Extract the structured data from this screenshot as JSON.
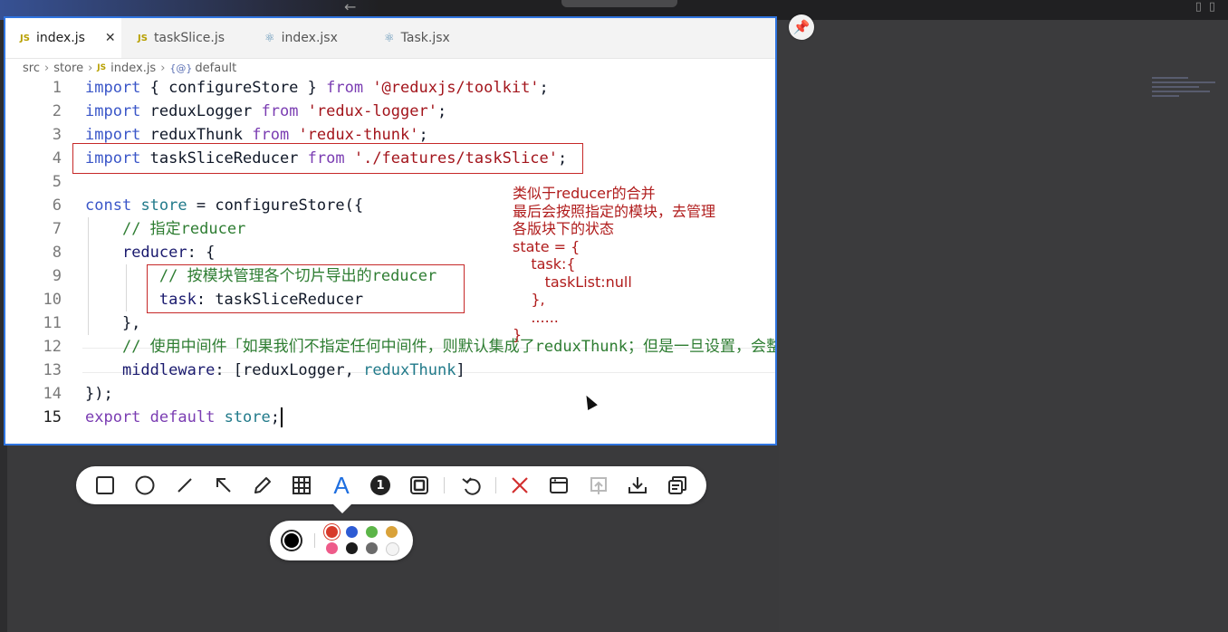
{
  "editor": {
    "tabs": [
      {
        "label": "index.js",
        "badge": "JS",
        "icon": "js-file-icon",
        "active": true,
        "close": "✕"
      },
      {
        "label": "taskSlice.js",
        "badge": "JS",
        "icon": "js-file-icon"
      },
      {
        "label": "index.jsx",
        "icon": "react-file-icon"
      },
      {
        "label": "Task.jsx",
        "icon": "react-file-icon"
      }
    ],
    "breadcrumb": {
      "folder1": "src",
      "folder2": "store",
      "file_badge": "JS",
      "file": "index.js",
      "symbol_icon": "{@}",
      "symbol": "default"
    },
    "lines": [
      {
        "n": "1",
        "parts": [
          [
            "kw",
            "import"
          ],
          [
            "var",
            " { configureStore } "
          ],
          [
            "ctl",
            "from"
          ],
          [
            "str",
            " '@reduxjs/toolkit'"
          ],
          [
            "var",
            ";"
          ]
        ]
      },
      {
        "n": "2",
        "parts": [
          [
            "kw",
            "import"
          ],
          [
            "var",
            " reduxLogger "
          ],
          [
            "ctl",
            "from"
          ],
          [
            "str",
            " 'redux-logger'"
          ],
          [
            "var",
            ";"
          ]
        ]
      },
      {
        "n": "3",
        "parts": [
          [
            "kw",
            "import"
          ],
          [
            "var",
            " reduxThunk "
          ],
          [
            "ctl",
            "from"
          ],
          [
            "str",
            " 'redux-thunk'"
          ],
          [
            "var",
            ";"
          ]
        ]
      },
      {
        "n": "4",
        "parts": [
          [
            "kw",
            "import"
          ],
          [
            "var",
            " taskSliceReducer "
          ],
          [
            "ctl",
            "from"
          ],
          [
            "str",
            " './features/taskSlice'"
          ],
          [
            "var",
            ";"
          ]
        ]
      },
      {
        "n": "5",
        "parts": []
      },
      {
        "n": "6",
        "parts": [
          [
            "kw",
            "const"
          ],
          [
            "var",
            " "
          ],
          [
            "cls",
            "store"
          ],
          [
            "var",
            " = configureStore({"
          ]
        ]
      },
      {
        "n": "7",
        "parts": [
          [
            "var",
            "    "
          ],
          [
            "cmt",
            "// 指定reducer"
          ]
        ]
      },
      {
        "n": "8",
        "parts": [
          [
            "var",
            "    "
          ],
          [
            "prop",
            "reducer"
          ],
          [
            "var",
            ": {"
          ]
        ]
      },
      {
        "n": "9",
        "parts": [
          [
            "var",
            "        "
          ],
          [
            "cmt",
            "// 按模块管理各个切片导出的reducer"
          ]
        ]
      },
      {
        "n": "10",
        "parts": [
          [
            "var",
            "        "
          ],
          [
            "prop",
            "task"
          ],
          [
            "var",
            ": taskSliceReducer"
          ]
        ]
      },
      {
        "n": "11",
        "parts": [
          [
            "var",
            "    },"
          ]
        ]
      },
      {
        "n": "12",
        "parts": [
          [
            "var",
            "    "
          ],
          [
            "cmt",
            "// 使用中间件「如果我们不指定任何中间件，则默认集成了reduxThunk；但是一旦设置，会整体替换默认值，需要手动指定thunk中间件！」"
          ]
        ]
      },
      {
        "n": "13",
        "parts": [
          [
            "var",
            "    "
          ],
          [
            "prop",
            "middleware"
          ],
          [
            "var",
            ": [reduxLogger, "
          ],
          [
            "cls",
            "reduxThunk"
          ],
          [
            "var",
            "]"
          ]
        ]
      },
      {
        "n": "14",
        "parts": [
          [
            "var",
            "});"
          ]
        ]
      },
      {
        "n": "15",
        "parts": [
          [
            "ctl",
            "export"
          ],
          [
            "var",
            " "
          ],
          [
            "ctl",
            "default"
          ],
          [
            "var",
            " "
          ],
          [
            "cls",
            "store"
          ],
          [
            "var",
            ";"
          ]
        ]
      }
    ]
  },
  "annotation": [
    "类似于reducer的合并",
    "最后会按照指定的模块，去管理",
    "各版块下的状态",
    "state = {",
    "    task:{",
    "       taskList:null",
    "    },",
    "    ......",
    "}"
  ],
  "toolbar": {
    "tools": [
      {
        "name": "rectangle-tool",
        "icon": "rectangle-icon"
      },
      {
        "name": "ellipse-tool",
        "icon": "circle-icon"
      },
      {
        "name": "line-tool",
        "icon": "line-icon"
      },
      {
        "name": "arrow-tool",
        "icon": "arrow-icon"
      },
      {
        "name": "pen-tool",
        "icon": "pencil-icon"
      },
      {
        "name": "mosaic-tool",
        "icon": "grid-icon"
      },
      {
        "name": "text-tool",
        "icon": "text-icon",
        "label": "A",
        "active": true
      },
      {
        "name": "number-tool",
        "icon": "number-badge-icon",
        "label": "1"
      },
      {
        "name": "highlight-tool",
        "icon": "highlight-box-icon"
      },
      {
        "name": "undo-button",
        "icon": "undo-icon"
      },
      {
        "name": "cancel-button",
        "icon": "close-icon"
      },
      {
        "name": "pin-screenshot-button",
        "icon": "window-icon"
      },
      {
        "name": "upload-button",
        "icon": "upload-icon",
        "disabled": true
      },
      {
        "name": "download-button",
        "icon": "download-icon"
      },
      {
        "name": "copy-button",
        "icon": "copy-icon"
      }
    ]
  },
  "palette": {
    "current_color": "#000000",
    "swatches": [
      "#d73a2a",
      "#2d5bd4",
      "#5cb548",
      "#d9a23a",
      "#ee5b8a",
      "#1c1c1c",
      "#6b6b6b",
      "#f4f4f4"
    ],
    "selected": "#d73a2a"
  },
  "colors": {
    "keyword": "#3a56c8",
    "string": "#a3151c",
    "comment": "#2e7d32",
    "annotation": "#b01c1c",
    "editor_border": "#2f74e0"
  }
}
